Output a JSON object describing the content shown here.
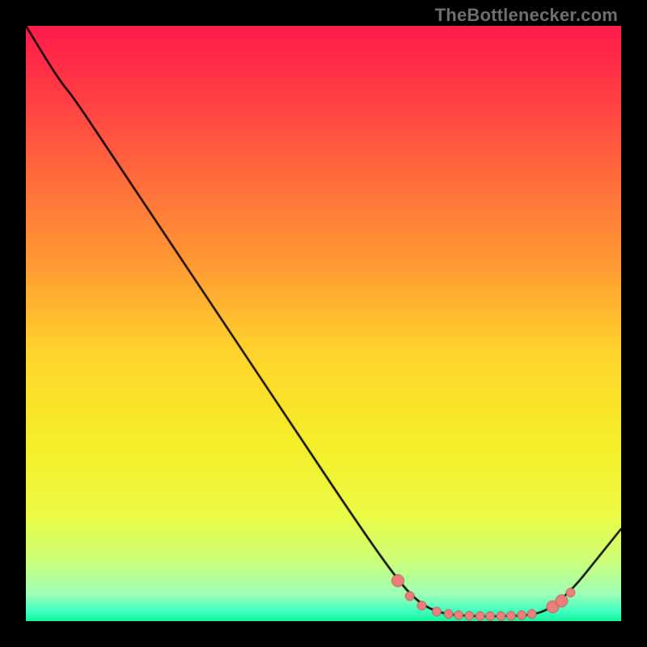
{
  "watermark_text": "TheBottlenecker.com",
  "chart_data": {
    "type": "line",
    "title": "",
    "xlabel": "",
    "ylabel": "",
    "xlim": [
      0,
      100
    ],
    "ylim": [
      0,
      100
    ],
    "background_gradient": {
      "stops": [
        {
          "offset": 0.0,
          "color": "#ff1b4b"
        },
        {
          "offset": 0.12,
          "color": "#ff3e44"
        },
        {
          "offset": 0.25,
          "color": "#ff6a3c"
        },
        {
          "offset": 0.4,
          "color": "#ff9a33"
        },
        {
          "offset": 0.55,
          "color": "#ffd52c"
        },
        {
          "offset": 0.7,
          "color": "#f5ef2a"
        },
        {
          "offset": 0.82,
          "color": "#ecfb45"
        },
        {
          "offset": 0.9,
          "color": "#cdff7a"
        },
        {
          "offset": 0.955,
          "color": "#9dffb7"
        },
        {
          "offset": 0.985,
          "color": "#3dffc0"
        },
        {
          "offset": 1.0,
          "color": "#13f59b"
        }
      ]
    },
    "series": [
      {
        "name": "bottleneck-curve",
        "stroke": "#000000",
        "stroke_width": 2.4,
        "points": [
          {
            "x": 0.0,
            "y": 100.0
          },
          {
            "x": 5.5,
            "y": 91.0
          },
          {
            "x": 8.0,
            "y": 88.0
          },
          {
            "x": 15.0,
            "y": 77.5
          },
          {
            "x": 25.0,
            "y": 62.5
          },
          {
            "x": 35.0,
            "y": 47.5
          },
          {
            "x": 45.0,
            "y": 32.5
          },
          {
            "x": 55.0,
            "y": 17.5
          },
          {
            "x": 62.0,
            "y": 7.5
          },
          {
            "x": 66.0,
            "y": 3.0
          },
          {
            "x": 70.0,
            "y": 1.2
          },
          {
            "x": 75.0,
            "y": 0.8
          },
          {
            "x": 80.0,
            "y": 0.8
          },
          {
            "x": 85.0,
            "y": 1.0
          },
          {
            "x": 88.0,
            "y": 2.0
          },
          {
            "x": 92.0,
            "y": 5.5
          },
          {
            "x": 96.0,
            "y": 10.5
          },
          {
            "x": 100.0,
            "y": 15.5
          }
        ]
      }
    ],
    "markers": {
      "color": "#ef7d7a",
      "outline": "#b95a58",
      "radius_small": 5.5,
      "radius_large": 7.5,
      "points": [
        {
          "x": 62.5,
          "y": 6.8,
          "r": "large"
        },
        {
          "x": 64.5,
          "y": 4.2,
          "r": "small"
        },
        {
          "x": 66.5,
          "y": 2.6,
          "r": "small"
        },
        {
          "x": 69.0,
          "y": 1.6,
          "r": "small"
        },
        {
          "x": 71.0,
          "y": 1.2,
          "r": "small"
        },
        {
          "x": 72.7,
          "y": 1.0,
          "r": "small"
        },
        {
          "x": 74.5,
          "y": 0.9,
          "r": "small"
        },
        {
          "x": 76.3,
          "y": 0.85,
          "r": "small"
        },
        {
          "x": 78.0,
          "y": 0.85,
          "r": "small"
        },
        {
          "x": 79.8,
          "y": 0.85,
          "r": "small"
        },
        {
          "x": 81.5,
          "y": 0.9,
          "r": "small"
        },
        {
          "x": 83.3,
          "y": 1.0,
          "r": "small"
        },
        {
          "x": 85.0,
          "y": 1.2,
          "r": "small"
        },
        {
          "x": 88.5,
          "y": 2.4,
          "r": "large"
        },
        {
          "x": 90.0,
          "y": 3.4,
          "r": "large"
        },
        {
          "x": 91.5,
          "y": 4.8,
          "r": "small"
        }
      ]
    }
  }
}
